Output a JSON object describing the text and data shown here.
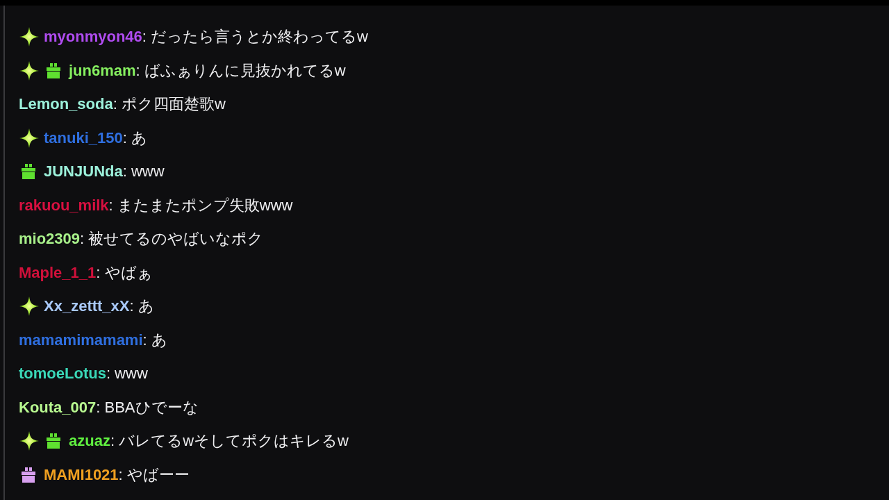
{
  "messages": [
    {
      "badges": [
        {
          "kind": "sparkle"
        }
      ],
      "user": "myonmyon46",
      "color": "#b04cf0",
      "text": ": だったら言うとか終わってるw"
    },
    {
      "badges": [
        {
          "kind": "sparkle"
        },
        {
          "kind": "gift",
          "color": "#5fe030"
        }
      ],
      "user": "jun6mam",
      "color": "#86f060",
      "text": ": ばふぁりんに見抜かれてるw"
    },
    {
      "user": "Lemon_soda",
      "color": "#9df2dc",
      "text": ": ポク四面楚歌w"
    },
    {
      "badges": [
        {
          "kind": "sparkle"
        }
      ],
      "user": "tanuki_150",
      "color": "#2f6fe0",
      "text": ": あ"
    },
    {
      "badges": [
        {
          "kind": "gift",
          "color": "#5fe030"
        }
      ],
      "user": "JUNJUNda",
      "color": "#9df2dc",
      "text": ": www"
    },
    {
      "user": "rakuou_milk",
      "color": "#d81040",
      "text": ": またまたポンプ失敗www"
    },
    {
      "user": "mio2309",
      "color": "#a8f08a",
      "text": ": 被せてるのやばいなポク"
    },
    {
      "user": "Maple_1_1",
      "color": "#d0103a",
      "text": ": やばぁ"
    },
    {
      "badges": [
        {
          "kind": "sparkle"
        }
      ],
      "user": "Xx_zettt_xX",
      "color": "#a8c8f8",
      "text": ": あ"
    },
    {
      "user": "mamamimamami",
      "color": "#2f6fe0",
      "text": ": あ"
    },
    {
      "user": "tomoeLotus",
      "color": "#3ad8b8",
      "text": ": www"
    },
    {
      "user": "Kouta_007",
      "color": "#b8f890",
      "text": ": BBAひでーな"
    },
    {
      "badges": [
        {
          "kind": "sparkle"
        },
        {
          "kind": "gift",
          "color": "#5fe030"
        }
      ],
      "user": "azuaz",
      "color": "#60f040",
      "text": ": バレてるwそしてポクはキレるw"
    },
    {
      "badges": [
        {
          "kind": "gift",
          "color": "#d8a0f0"
        }
      ],
      "user": "MAMI1021",
      "color": "#f0a020",
      "text": ": やばーー"
    }
  ]
}
